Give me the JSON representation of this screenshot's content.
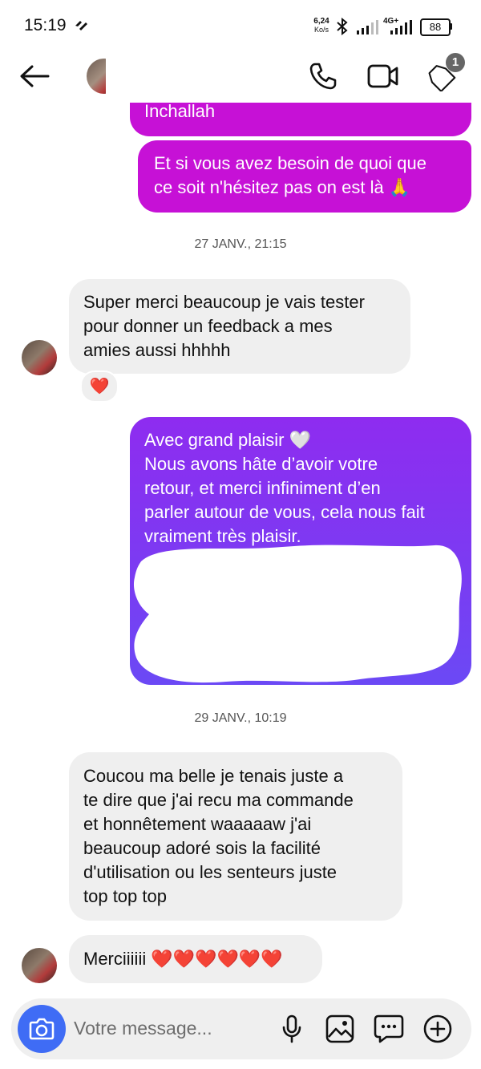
{
  "status_bar": {
    "time": "15:19",
    "speed_value": "6,24",
    "speed_unit": "Ko/s",
    "network": "4G+",
    "battery": "88"
  },
  "header": {
    "notification_count": "1"
  },
  "messages": [
    {
      "type": "sent",
      "text_lines": [
        "Inchallah"
      ]
    },
    {
      "type": "sent",
      "text_lines": [
        "Et si vous avez besoin de quoi que",
        "ce soit n'hésitez pas on est là 🙏"
      ]
    },
    {
      "type": "timestamp",
      "text": "27 JANV., 21:15"
    },
    {
      "type": "received",
      "text_lines": [
        "Super merci beaucoup je vais tester",
        "pour donner un feedback a mes",
        "amies aussi hhhhh"
      ],
      "reaction": "❤️"
    },
    {
      "type": "sent",
      "text_lines": [
        "Avec grand plaisir 🤍",
        "Nous avons hâte d’avoir votre",
        "retour, et merci infiniment d’en",
        "parler autour de vous, cela nous fait",
        "vraiment très plaisir."
      ]
    },
    {
      "type": "timestamp",
      "text": "29 JANV., 10:19"
    },
    {
      "type": "received",
      "text_lines": [
        "Coucou ma belle je tenais juste a",
        "te dire que j'ai recu ma commande",
        "et honnêtement waaaaaw j'ai",
        "beaucoup adoré sois la facilité",
        "d'utilisation ou les senteurs juste",
        "top top top"
      ]
    },
    {
      "type": "received",
      "text_lines": [
        "Merciiiiii ❤️❤️❤️❤️❤️❤️"
      ]
    }
  ],
  "composer": {
    "placeholder": "Votre message..."
  },
  "colors": {
    "sent_magenta": "#c611d6",
    "sent_purple": "#8e2cf0",
    "received_bg": "#efefef",
    "camera_blue": "#3f6cf5"
  }
}
